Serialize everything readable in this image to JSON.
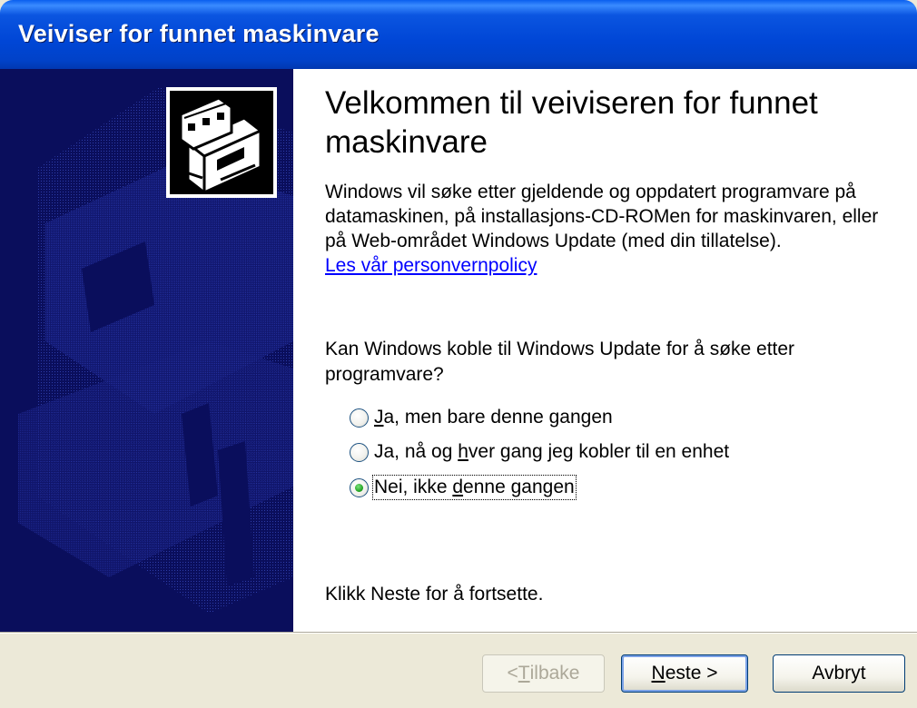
{
  "window": {
    "title": "Veiviser for funnet maskinvare"
  },
  "content": {
    "heading": "Velkommen til veiviseren for funnet maskinvare",
    "description": "Windows vil søke etter gjeldende og oppdatert programvare på datamaskinen, på installasjons-CD-ROMen for maskinvaren, eller på Web-området Windows Update (med din tillatelse).",
    "privacy_link": "Les vår personvernpolicy",
    "question": "Kan Windows koble til Windows Update for å søke etter programvare?",
    "options": [
      {
        "pre": "",
        "key": "J",
        "post": "a, men bare denne gangen",
        "checked": false
      },
      {
        "pre": "Ja, nå og ",
        "key": "h",
        "post": "ver gang jeg kobler til en enhet",
        "checked": false
      },
      {
        "pre": "Nei, ikke ",
        "key": "d",
        "post": "enne gangen",
        "checked": true
      }
    ],
    "footer": "Klikk Neste for å fortsette."
  },
  "buttons": {
    "back": {
      "pre": "< ",
      "key": "T",
      "post": "ilbake",
      "enabled": false
    },
    "next": {
      "pre": "",
      "key": "N",
      "post": "este >",
      "enabled": true
    },
    "cancel": {
      "label": "Avbryt",
      "enabled": true
    }
  },
  "colors": {
    "titlebar": "#0046D6",
    "banner": "#0A0E5C",
    "link": "#0000FF",
    "dialog_bg": "#ECE9D8"
  },
  "icons": {
    "banner_illustration": "hardware-card-icon"
  }
}
